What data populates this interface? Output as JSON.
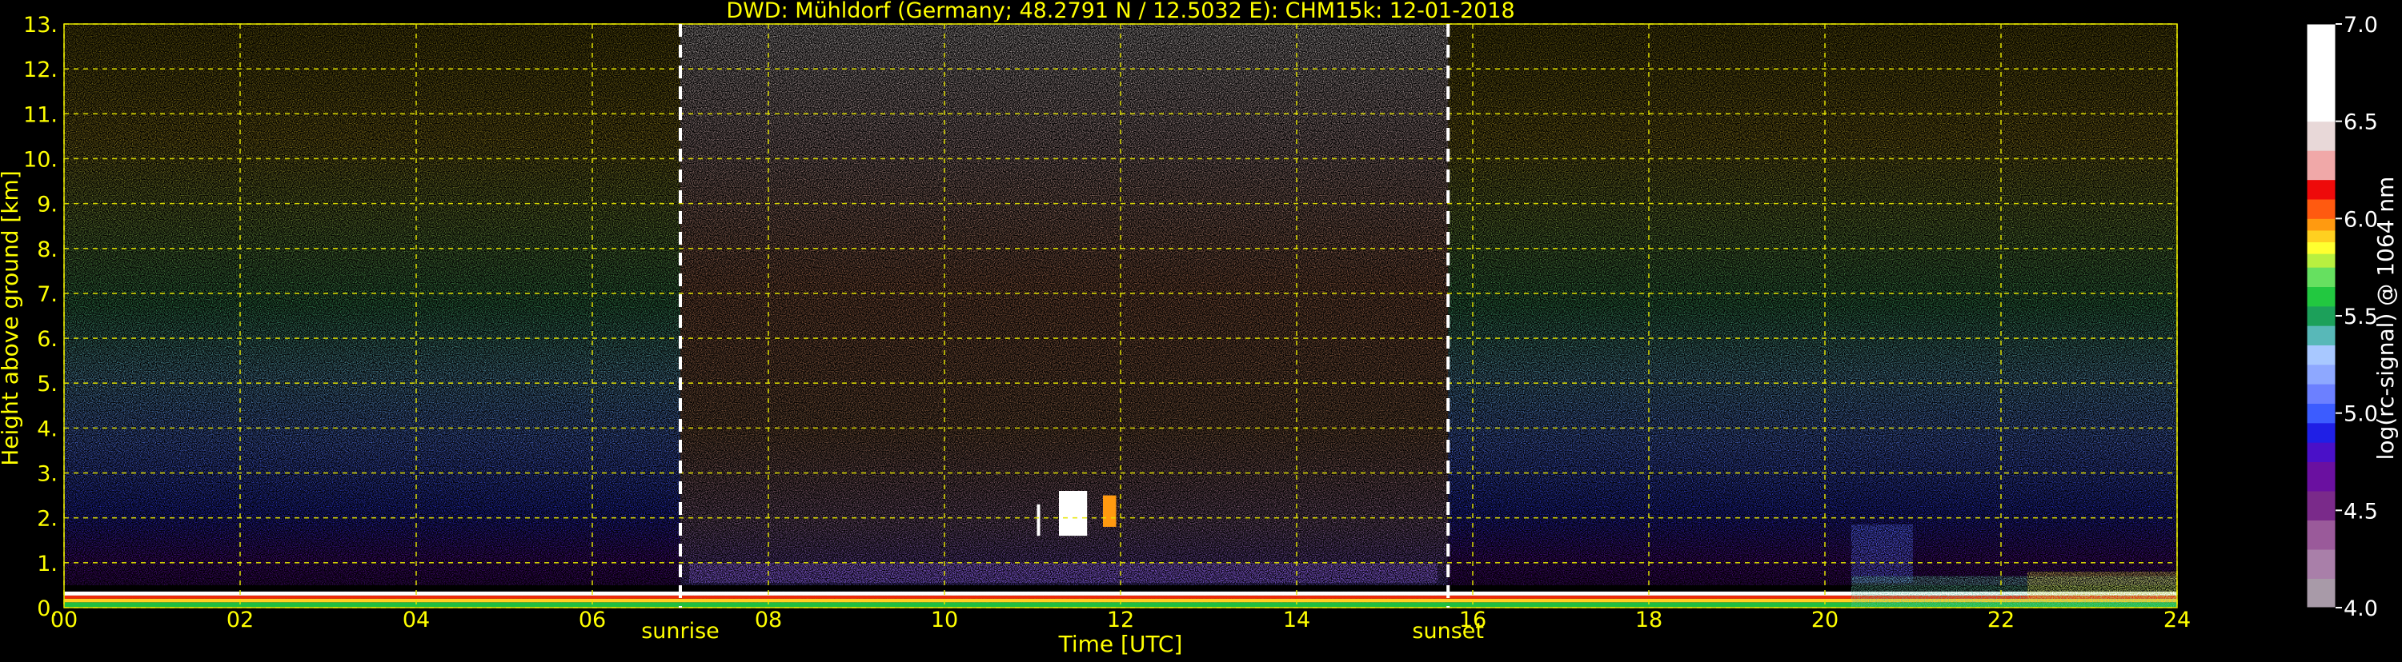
{
  "chart_data": {
    "type": "heatmap",
    "title": "DWD: Mühldorf (Germany; 48.2791 N / 12.5032 E):    CHM15k: 12-01-2018",
    "xlabel": "Time [UTC]",
    "ylabel": "Height above ground [km]",
    "xlim": [
      0,
      24
    ],
    "ylim": [
      0,
      13
    ],
    "x_ticks": [
      {
        "value": 0,
        "label": "00"
      },
      {
        "value": 2,
        "label": "02"
      },
      {
        "value": 4,
        "label": "04"
      },
      {
        "value": 6,
        "label": "06"
      },
      {
        "value": 8,
        "label": "08"
      },
      {
        "value": 10,
        "label": "10"
      },
      {
        "value": 12,
        "label": "12"
      },
      {
        "value": 14,
        "label": "14"
      },
      {
        "value": 16,
        "label": "16"
      },
      {
        "value": 18,
        "label": "18"
      },
      {
        "value": 20,
        "label": "20"
      },
      {
        "value": 22,
        "label": "22"
      },
      {
        "value": 24,
        "label": "24"
      }
    ],
    "y_ticks": [
      {
        "value": 0,
        "label": "0."
      },
      {
        "value": 1,
        "label": "1."
      },
      {
        "value": 2,
        "label": "2."
      },
      {
        "value": 3,
        "label": "3."
      },
      {
        "value": 4,
        "label": "4."
      },
      {
        "value": 5,
        "label": "5."
      },
      {
        "value": 6,
        "label": "6."
      },
      {
        "value": 7,
        "label": "7."
      },
      {
        "value": 8,
        "label": "8."
      },
      {
        "value": 9,
        "label": "9."
      },
      {
        "value": 10,
        "label": "10."
      },
      {
        "value": 11,
        "label": "11."
      },
      {
        "value": 12,
        "label": "12."
      },
      {
        "value": 13,
        "label": "13."
      }
    ],
    "grid": true,
    "annotations": [
      {
        "name": "sunrise",
        "label": "sunrise",
        "x": 7.0
      },
      {
        "name": "sunset",
        "label": "sunset",
        "x": 15.72
      }
    ],
    "colorbar": {
      "label": "log(rc-signal) @ 1064 nm",
      "range": [
        4.0,
        7.0
      ],
      "ticks": [
        {
          "value": 4.0,
          "label": "4.0"
        },
        {
          "value": 4.5,
          "label": "4.5"
        },
        {
          "value": 5.0,
          "label": "5.0"
        },
        {
          "value": 5.5,
          "label": "5.5"
        },
        {
          "value": 6.0,
          "label": "6.0"
        },
        {
          "value": 6.5,
          "label": "6.5"
        },
        {
          "value": 7.0,
          "label": "7.0"
        }
      ],
      "levels": [
        {
          "from": 4.0,
          "to": 4.15,
          "color": "#a89aa8"
        },
        {
          "from": 4.15,
          "to": 4.3,
          "color": "#a97fa9"
        },
        {
          "from": 4.3,
          "to": 4.45,
          "color": "#9a5a9a"
        },
        {
          "from": 4.45,
          "to": 4.6,
          "color": "#7a2a8a"
        },
        {
          "from": 4.6,
          "to": 4.75,
          "color": "#6a10a0"
        },
        {
          "from": 4.75,
          "to": 4.85,
          "color": "#4a10c8"
        },
        {
          "from": 4.85,
          "to": 4.95,
          "color": "#1f1fe6"
        },
        {
          "from": 4.95,
          "to": 5.05,
          "color": "#3c5cff"
        },
        {
          "from": 5.05,
          "to": 5.15,
          "color": "#6c80ff"
        },
        {
          "from": 5.15,
          "to": 5.25,
          "color": "#8ea8ff"
        },
        {
          "from": 5.25,
          "to": 5.35,
          "color": "#a8c8ff"
        },
        {
          "from": 5.35,
          "to": 5.45,
          "color": "#58b8b8"
        },
        {
          "from": 5.45,
          "to": 5.55,
          "color": "#1ca05a"
        },
        {
          "from": 5.55,
          "to": 5.65,
          "color": "#22c840"
        },
        {
          "from": 5.65,
          "to": 5.75,
          "color": "#66e060"
        },
        {
          "from": 5.75,
          "to": 5.82,
          "color": "#b8f040"
        },
        {
          "from": 5.82,
          "to": 5.88,
          "color": "#ffff30"
        },
        {
          "from": 5.88,
          "to": 5.94,
          "color": "#ffd020"
        },
        {
          "from": 5.94,
          "to": 6.0,
          "color": "#ff9a10"
        },
        {
          "from": 6.0,
          "to": 6.1,
          "color": "#ff5a10"
        },
        {
          "from": 6.1,
          "to": 6.2,
          "color": "#ee0a0a"
        },
        {
          "from": 6.2,
          "to": 6.35,
          "color": "#f0a8a8"
        },
        {
          "from": 6.35,
          "to": 6.5,
          "color": "#e8d8d8"
        },
        {
          "from": 6.5,
          "to": 7.0,
          "color": "#ffffff"
        }
      ]
    }
  },
  "colors": {
    "text": "#ffff00",
    "grid": "#e6e600",
    "background": "#000000",
    "annotation_line": "#ffffff",
    "colorbar_text": "#ffffff"
  }
}
